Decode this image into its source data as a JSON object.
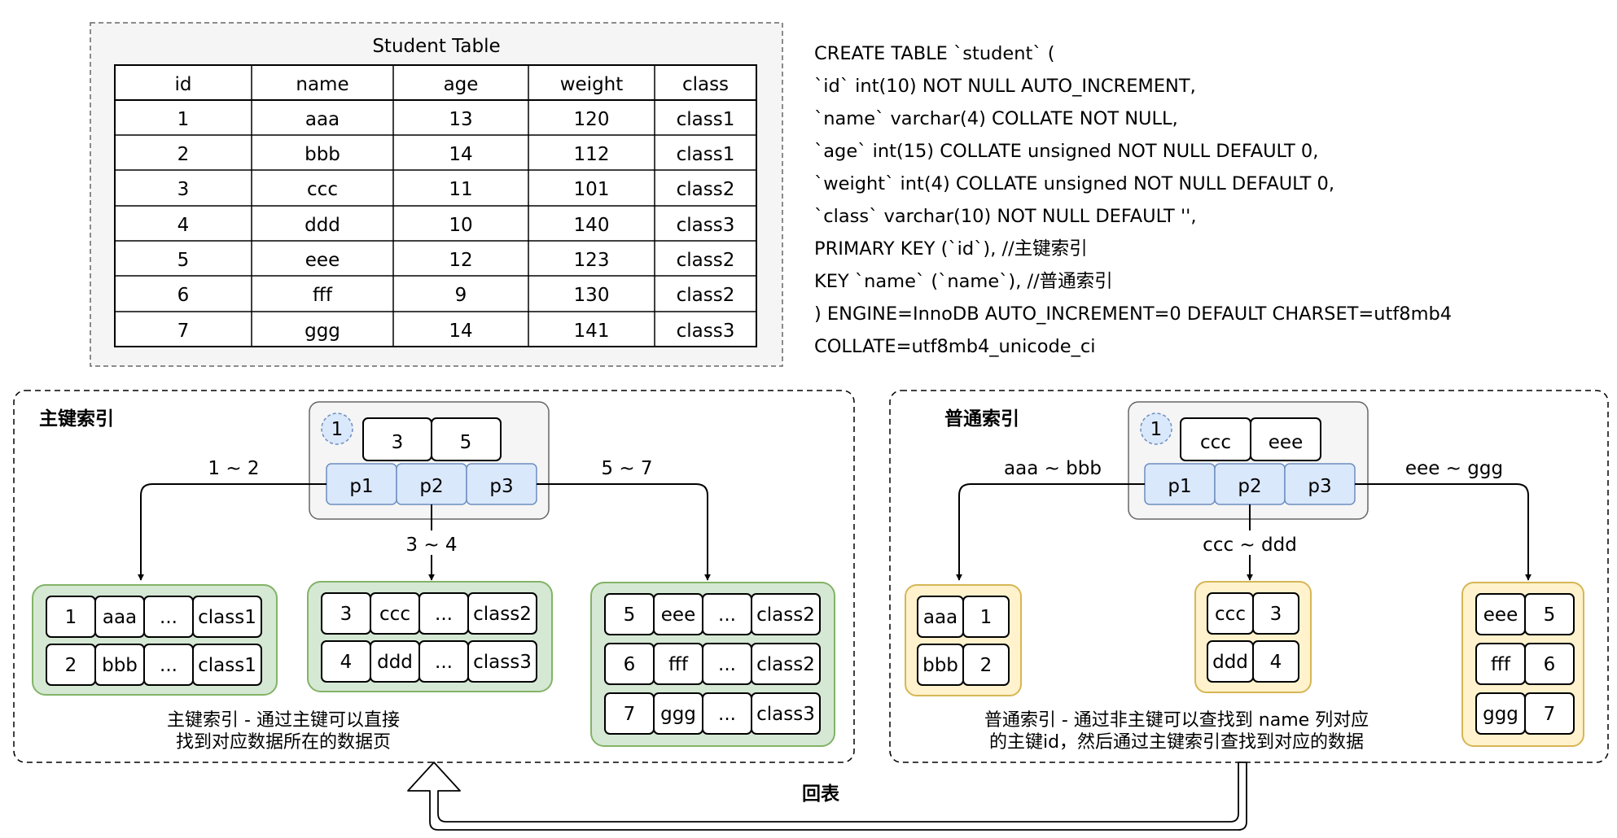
{
  "student_table": {
    "title": "Student Table",
    "columns": [
      "id",
      "name",
      "age",
      "weight",
      "class"
    ],
    "rows": [
      [
        "1",
        "aaa",
        "13",
        "120",
        "class1"
      ],
      [
        "2",
        "bbb",
        "14",
        "112",
        "class1"
      ],
      [
        "3",
        "ccc",
        "11",
        "101",
        "class2"
      ],
      [
        "4",
        "ddd",
        "10",
        "140",
        "class3"
      ],
      [
        "5",
        "eee",
        "12",
        "123",
        "class2"
      ],
      [
        "6",
        "fff",
        "9",
        "130",
        "class2"
      ],
      [
        "7",
        "ggg",
        "14",
        "141",
        "class3"
      ]
    ]
  },
  "sql": [
    "CREATE TABLE `student` (",
    "`id` int(10) NOT NULL AUTO_INCREMENT,",
    "`name` varchar(4) COLLATE NOT NULL,",
    "`age` int(15) COLLATE unsigned NOT NULL DEFAULT 0,",
    "`weight` int(4) COLLATE unsigned NOT NULL DEFAULT 0,",
    "`class` varchar(10) NOT NULL DEFAULT '',",
    "PRIMARY KEY (`id`),    //主键索引",
    "KEY `name` (`name`),  //普通索引",
    ") ENGINE=InnoDB AUTO_INCREMENT=0 DEFAULT CHARSET=utf8mb4",
    "COLLATE=utf8mb4_unicode_ci"
  ],
  "primary_index": {
    "title": "主键索引",
    "root_badge": "1",
    "root_keys": [
      "3",
      "5"
    ],
    "pointers": [
      "p1",
      "p2",
      "p3"
    ],
    "edge_labels": [
      "1 ~ 2",
      "3 ~ 4",
      "5 ~ 7"
    ],
    "leaf_pages": [
      [
        [
          "1",
          "aaa",
          "...",
          "class1"
        ],
        [
          "2",
          "bbb",
          "...",
          "class1"
        ]
      ],
      [
        [
          "3",
          "ccc",
          "...",
          "class2"
        ],
        [
          "4",
          "ddd",
          "...",
          "class3"
        ]
      ],
      [
        [
          "5",
          "eee",
          "...",
          "class2"
        ],
        [
          "6",
          "fff",
          "...",
          "class2"
        ],
        [
          "7",
          "ggg",
          "...",
          "class3"
        ]
      ]
    ],
    "caption": [
      "主键索引 - 通过主键可以直接",
      "找到对应数据所在的数据页"
    ]
  },
  "secondary_index": {
    "title": "普通索引",
    "root_badge": "1",
    "root_keys": [
      "ccc",
      "eee"
    ],
    "pointers": [
      "p1",
      "p2",
      "p3"
    ],
    "edge_labels": [
      "aaa ~ bbb",
      "ccc ~ ddd",
      "eee ~ ggg"
    ],
    "leaf_pages": [
      [
        [
          "aaa",
          "1"
        ],
        [
          "bbb",
          "2"
        ]
      ],
      [
        [
          "ccc",
          "3"
        ],
        [
          "ddd",
          "4"
        ]
      ],
      [
        [
          "eee",
          "5"
        ],
        [
          "fff",
          "6"
        ],
        [
          "ggg",
          "7"
        ]
      ]
    ],
    "caption": [
      "普通索引 - 通过非主键可以查找到 name 列对应",
      "的主键id，然后通过主键索引查找到对应的数据"
    ]
  },
  "lookup_back_label": "回表"
}
